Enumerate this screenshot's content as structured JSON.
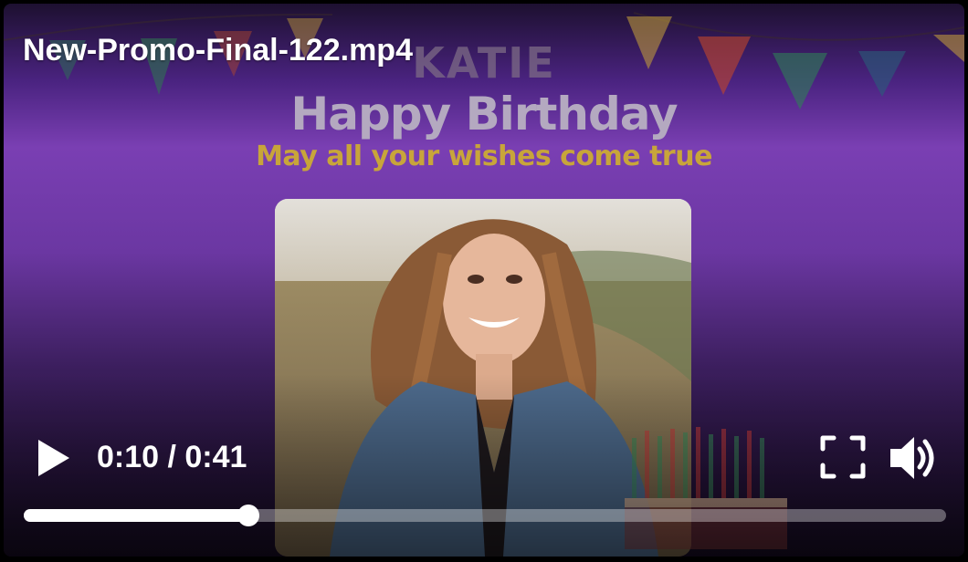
{
  "player": {
    "file_title": "New-Promo-Final-122.mp4",
    "time_display": "0:10 / 0:41",
    "current_seconds": 10,
    "duration_seconds": 41,
    "progress_fraction": 0.2439
  },
  "video_frame": {
    "name": "KATIE",
    "headline": "Happy Birthday",
    "subline": "May all your wishes come true"
  },
  "icons": {
    "play": "play-icon",
    "fullscreen": "fullscreen-icon",
    "volume": "volume-icon"
  },
  "colors": {
    "gradient_mid": "#7a3fb3",
    "subline_gold": "#c8a53a",
    "headline_gray": "#b4a9c0",
    "control_white": "#ffffff"
  }
}
